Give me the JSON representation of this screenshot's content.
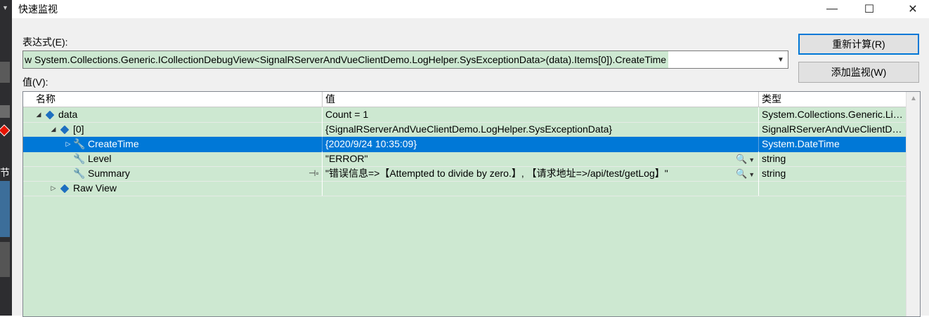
{
  "window": {
    "title": "快速监视",
    "minimize_glyph": "—",
    "maximize_glyph": "☐",
    "close_glyph": "✕"
  },
  "left_strip": {
    "text": "节"
  },
  "dialog": {
    "expression_label": "表达式(E):",
    "expression_value": "w System.Collections.Generic.ICollectionDebugView<SignalRServerAndVueClientDemo.LogHelper.SysExceptionData>(data).Items[0]).CreateTime",
    "value_label": "值(V):",
    "recalc_button": "重新计算(R)",
    "add_watch_button": "添加监视(W)"
  },
  "grid": {
    "columns": {
      "name": "名称",
      "value": "值",
      "type": "类型"
    },
    "rows": [
      {
        "indent": 0,
        "expander": "◢",
        "icon": "object-cube-icon",
        "name": "data",
        "value": "Count = 1",
        "type": "System.Collections.Generic.Li…",
        "selected": false
      },
      {
        "indent": 1,
        "expander": "◢",
        "icon": "object-cube-icon",
        "name": "[0]",
        "value": "{SignalRServerAndVueClientDemo.LogHelper.SysExceptionData}",
        "type": "SignalRServerAndVueClientD…",
        "selected": false
      },
      {
        "indent": 2,
        "expander": "▷",
        "icon": "property-wrench-icon",
        "name": "CreateTime",
        "value": "{2020/9/24 10:35:09}",
        "type": "System.DateTime",
        "selected": true
      },
      {
        "indent": 2,
        "expander": "",
        "icon": "property-wrench-icon",
        "name": "Level",
        "value": "\"ERROR\"",
        "type": "string",
        "selected": false
      },
      {
        "indent": 2,
        "expander": "",
        "icon": "property-wrench-icon",
        "name": "Summary",
        "value": "\"错误信息=>【Attempted to divide by zero.】, 【请求地址=>/api/test/getLog】\"",
        "type": "string",
        "selected": false
      },
      {
        "indent": 1,
        "expander": "▷",
        "icon": "object-cube-icon",
        "name": "Raw View",
        "value": "",
        "type": "",
        "selected": false
      }
    ]
  },
  "colors": {
    "accent": "#0078d7",
    "grid_bg": "#cde8d1",
    "selection": "#0078d7"
  }
}
